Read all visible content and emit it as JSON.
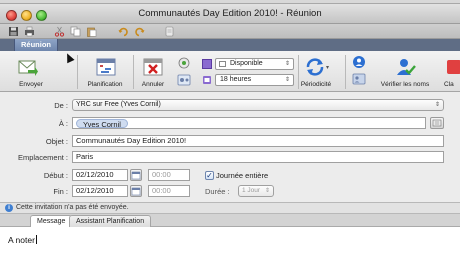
{
  "window": {
    "title": "Communautés Day Edition 2010! - Réunion"
  },
  "ribbon": {
    "active_tab": "Réunion",
    "buttons": {
      "send": "Envoyer",
      "planning": "Planification",
      "cancel": "Annuler",
      "recurrence": "Périodicité",
      "check_names": "Vérifier les noms",
      "cl": "Cla"
    },
    "status_select": "Disponible",
    "reminder_select": "18 heures"
  },
  "form": {
    "from_label": "De :",
    "from_value": "YRC sur Free (Yves Cornil)",
    "to_label": "À :",
    "to_token": "Yves Cornil",
    "subject_label": "Objet :",
    "subject_value": "Communautés Day Edition 2010!",
    "location_label": "Emplacement :",
    "location_value": "Paris",
    "start_label": "Début :",
    "start_date": "02/12/2010",
    "start_time": "00:00",
    "allday_label": "Journée entière",
    "allday_checked": true,
    "end_label": "Fin :",
    "end_date": "02/12/2010",
    "end_time": "00:00",
    "duration_label": "Durée :",
    "duration_value": "1 Jour"
  },
  "info_bar": {
    "text": "Cette invitation n'a pas été envoyée."
  },
  "message_tabs": {
    "message": "Message",
    "assistant": "Assistant Planification"
  },
  "body": {
    "text": "A noter"
  },
  "colors": {
    "ribbon_tab_bar": "#5f6d85",
    "active_ribbon_tab": "#7f96bd",
    "form_background": "#ececec",
    "token": "#cfdcf0"
  }
}
